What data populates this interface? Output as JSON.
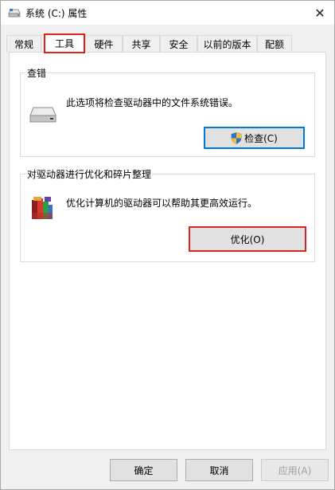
{
  "window": {
    "title": "系统 (C:) 属性",
    "close_glyph": "✕"
  },
  "tabs": [
    {
      "label": "常规"
    },
    {
      "label": "工具"
    },
    {
      "label": "硬件"
    },
    {
      "label": "共享"
    },
    {
      "label": "安全"
    },
    {
      "label": "以前的版本"
    },
    {
      "label": "配额"
    }
  ],
  "active_tab": "工具",
  "check_group": {
    "title": "查错",
    "description": "此选项将检查驱动器中的文件系统错误。",
    "button_label": "检查(C)",
    "icon": "drive-icon"
  },
  "optimize_group": {
    "title": "对驱动器进行优化和碎片整理",
    "description": "优化计算机的驱动器可以帮助其更高效运行。",
    "button_label": "优化(O)",
    "icon": "defrag-icon"
  },
  "footer": {
    "ok_label": "确定",
    "cancel_label": "取消",
    "apply_label": "应用(A)"
  },
  "colors": {
    "highlight_red": "#d9261c",
    "focus_blue": "#0078d7"
  }
}
